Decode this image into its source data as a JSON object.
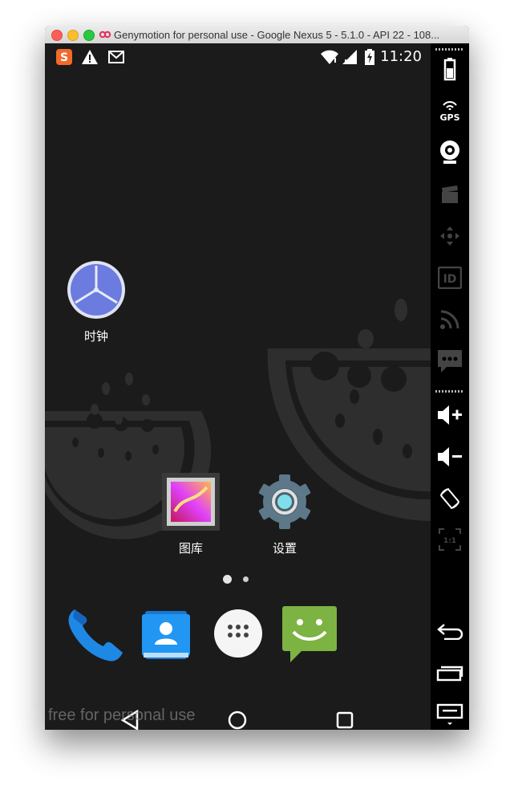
{
  "window": {
    "title": "Genymotion for personal use - Google Nexus 5 - 5.1.0 - API 22 - 108..."
  },
  "statusbar": {
    "time": "11:20",
    "left_icons": [
      "sogou-input-icon",
      "warning-icon",
      "gmail-icon"
    ],
    "right_icons": [
      "wifi-icon",
      "signal-icon",
      "battery-icon"
    ]
  },
  "home": {
    "apps": [
      {
        "label": "时钟",
        "icon": "clock-icon"
      },
      {
        "label": "图库",
        "icon": "gallery-icon"
      },
      {
        "label": "设置",
        "icon": "settings-icon"
      }
    ],
    "pages": 2,
    "current_page": 1
  },
  "dock": {
    "items": [
      "phone-icon",
      "contacts-icon",
      "app-drawer-icon",
      "messaging-icon"
    ]
  },
  "navbar": {
    "buttons": [
      "back",
      "home",
      "recents"
    ]
  },
  "watermark": "free for personal use",
  "sidebar": {
    "gps_label": "GPS",
    "id_label": "ID",
    "ratio_label": "1:1",
    "tools": [
      "battery",
      "gps",
      "webcam",
      "screencast",
      "remote-control",
      "device-id",
      "network",
      "sms",
      "volume-up",
      "volume-down",
      "rotate",
      "pixel-perfect",
      "back",
      "recent-apps",
      "menu"
    ]
  }
}
